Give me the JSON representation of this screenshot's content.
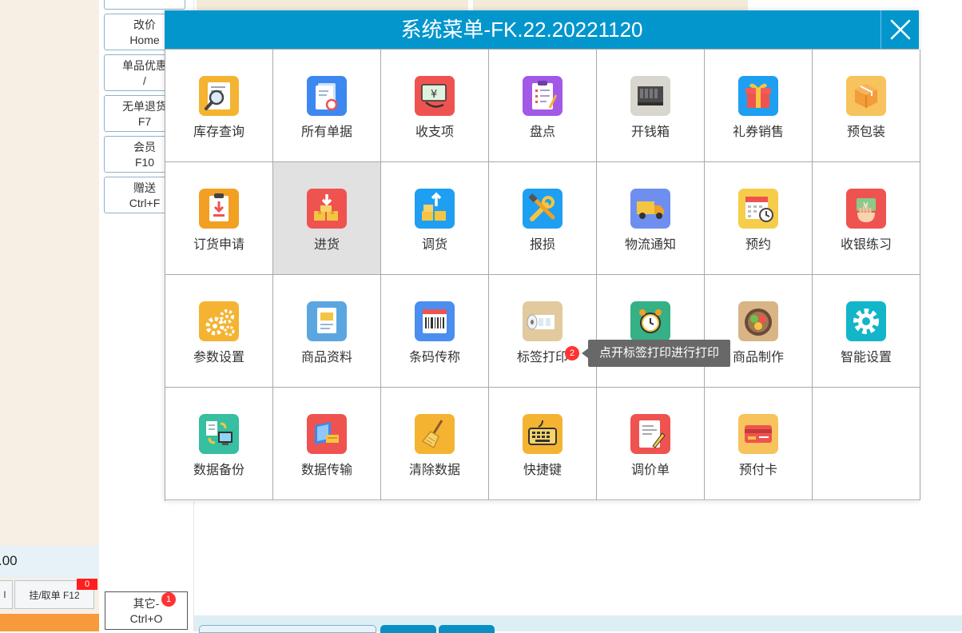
{
  "dialog": {
    "title": "系统菜单-FK.22.20221120",
    "items": [
      {
        "label": "库存查询",
        "icon": "inventory-search-icon",
        "color": "#f4b331"
      },
      {
        "label": "所有单据",
        "icon": "documents-icon",
        "color": "#3d88f0"
      },
      {
        "label": "收支项",
        "icon": "cash-flow-icon",
        "color": "#ef5350"
      },
      {
        "label": "盘点",
        "icon": "stocktake-icon",
        "color": "#a259e6"
      },
      {
        "label": "开钱箱",
        "icon": "cash-drawer-icon",
        "color": "#d9d6cf"
      },
      {
        "label": "礼券销售",
        "icon": "gift-icon",
        "color": "#1e9ff2"
      },
      {
        "label": "预包装",
        "icon": "package-icon",
        "color": "#f6c35c"
      },
      {
        "label": "订货申请",
        "icon": "order-request-icon",
        "color": "#f2a024"
      },
      {
        "label": "进货",
        "icon": "purchase-icon",
        "color": "#ef5350",
        "selected": true
      },
      {
        "label": "调货",
        "icon": "transfer-icon",
        "color": "#1e9ff2"
      },
      {
        "label": "报损",
        "icon": "tools-icon",
        "color": "#1e9ff2"
      },
      {
        "label": "物流通知",
        "icon": "truck-icon",
        "color": "#6f8ff0"
      },
      {
        "label": "预约",
        "icon": "calendar-icon",
        "color": "#f6cd4a"
      },
      {
        "label": "收银练习",
        "icon": "cashier-practice-icon",
        "color": "#ef5350"
      },
      {
        "label": "参数设置",
        "icon": "gears-icon",
        "color": "#f4b331"
      },
      {
        "label": "商品资料",
        "icon": "product-info-icon",
        "color": "#5ba6e0"
      },
      {
        "label": "条码传称",
        "icon": "barcode-icon",
        "color": "#4a8ef0"
      },
      {
        "label": "标签打印",
        "icon": "label-roll-icon",
        "color": "#e2c99e"
      },
      {
        "label": "",
        "icon": "alarm-clock-icon",
        "color": "#36b085"
      },
      {
        "label": "商品制作",
        "icon": "food-bowl-icon",
        "color": "#d9b585"
      },
      {
        "label": "智能设置",
        "icon": "smart-settings-icon",
        "color": "#13b5c8"
      },
      {
        "label": "数据备份",
        "icon": "data-backup-icon",
        "color": "#36bfa0"
      },
      {
        "label": "数据传输",
        "icon": "data-transfer-icon",
        "color": "#ef5350"
      },
      {
        "label": "清除数据",
        "icon": "broom-icon",
        "color": "#f4b331"
      },
      {
        "label": "快捷键",
        "icon": "keyboard-icon",
        "color": "#f4b331"
      },
      {
        "label": "调价单",
        "icon": "price-doc-icon",
        "color": "#ef5350"
      },
      {
        "label": "预付卡",
        "icon": "prepaid-card-icon",
        "color": "#f6c35c"
      },
      {
        "label": "",
        "icon": "",
        "color": ""
      }
    ],
    "tooltip": "点开标签打印进行打印",
    "badge": "2"
  },
  "sidebar": {
    "buttons": [
      {
        "line1": "改价",
        "line2": "Home"
      },
      {
        "line1": "单品优惠",
        "line2": "/"
      },
      {
        "line1": "无单退货",
        "line2": "F7"
      },
      {
        "line1": "会员",
        "line2": "F10"
      },
      {
        "line1": "赠送",
        "line2": "Ctrl+F"
      }
    ],
    "other": {
      "line1": "其它-",
      "line2": "Ctrl+O",
      "badge": "1"
    }
  },
  "left_panel": {
    "total": ".00",
    "btn_partial": "l",
    "hang_button": "挂/取单 F12",
    "hang_badge": "0"
  }
}
